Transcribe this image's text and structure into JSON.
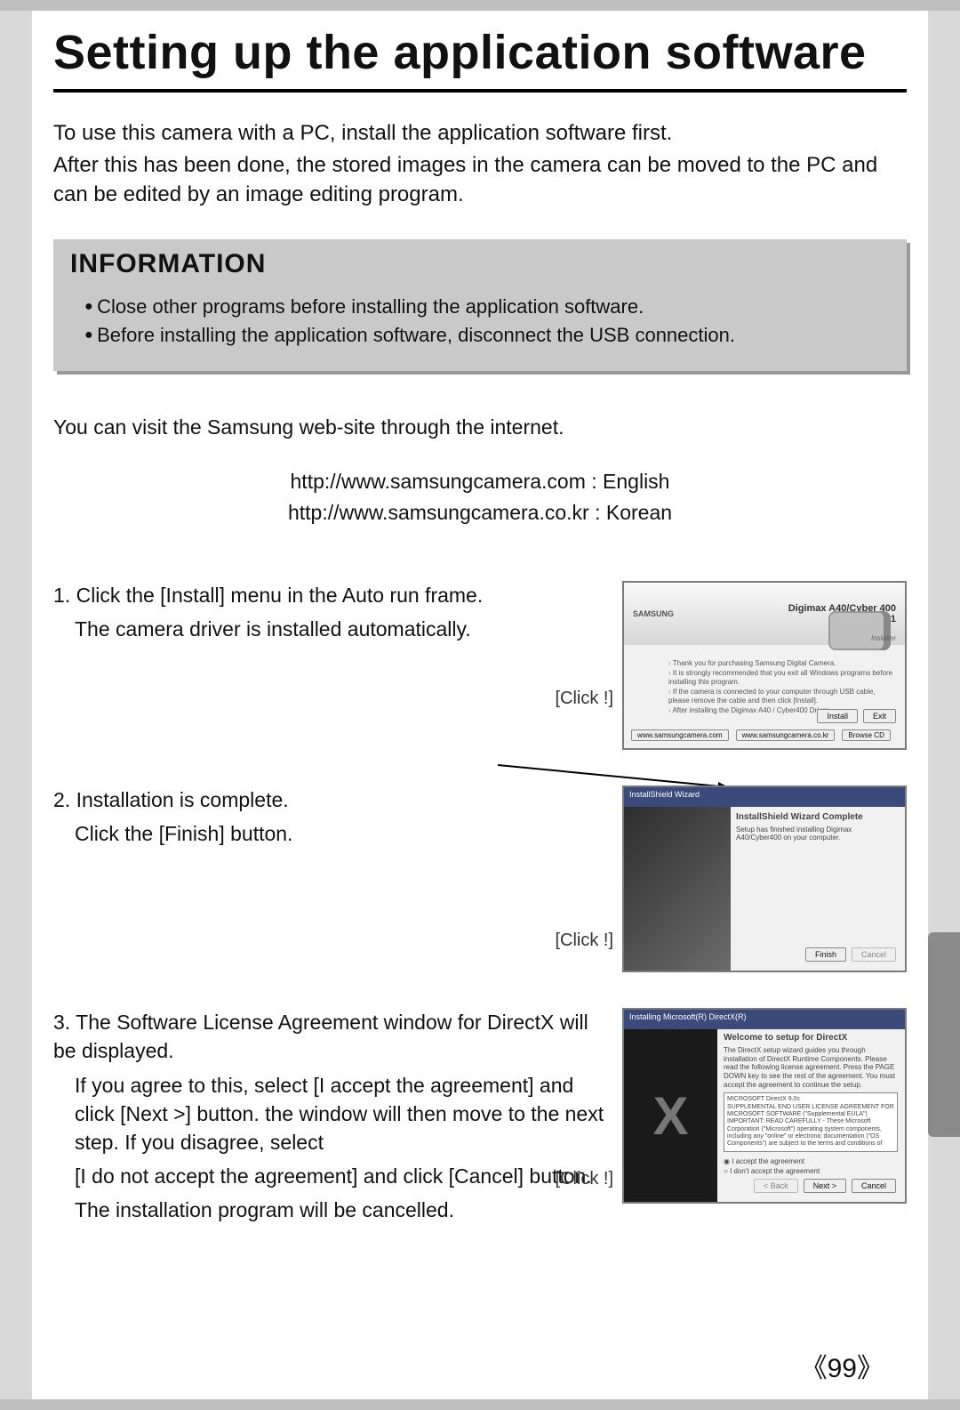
{
  "page": {
    "title": "Setting up the application software",
    "number": "《99》"
  },
  "intro": {
    "l1": "To use this camera with a PC, install the application software first.",
    "l2": "After this has been done, the stored images in the camera can be moved to the PC and can be edited by an image editing program."
  },
  "info": {
    "heading": "INFORMATION",
    "bullets": [
      "Close other programs before installing the application software.",
      "Before installing the application software, disconnect the USB connection."
    ]
  },
  "web": {
    "lead": "You can visit the Samsung web-site through the internet.",
    "links": [
      "http://www.samsungcamera.com : English",
      "http://www.samsungcamera.co.kr : Korean"
    ]
  },
  "steps": [
    {
      "num": "1.",
      "text": [
        "Click the [Install] menu in the Auto run frame.",
        "The camera driver is installed automatically."
      ],
      "click": "[Click !]"
    },
    {
      "num": "2.",
      "text": [
        "Installation is complete.",
        "Click the [Finish] button."
      ],
      "click": "[Click !]"
    },
    {
      "num": "3.",
      "text": [
        "The Software License Agreement window for DirectX will be displayed.",
        "If you agree to this, select [I accept the agreement] and click [Next >] button. the window will then move to the next step. If you disagree, select",
        "[I do not accept the agreement] and click [Cancel] button.",
        "The installation program will be cancelled."
      ],
      "click": "[Click !]"
    }
  ],
  "shot1": {
    "brand": "SAMSUNG",
    "model1": "Digimax A40/Cyber 400",
    "model2": "KENOX Q1",
    "badge": "Installer",
    "bul": [
      "Thank you for purchasing Samsung Digital Camera.",
      "It is strongly recommended that you exit all Windows programs before installing this program.",
      "If the camera is connected to your computer through USB cable, please remove the cable and then click [Install].",
      "After installing the Digimax A40 / Cyber400 Driver,"
    ],
    "btn_install": "Install",
    "btn_exit": "Exit",
    "footer1": "www.samsungcamera.com",
    "footer2": "www.samsungcamera.co.kr",
    "footer3": "Browse CD"
  },
  "shot2": {
    "titlebar": "InstallShield Wizard",
    "heading": "InstallShield Wizard Complete",
    "text": "Setup has finished installing Digimax A40/Cyber400 on your computer.",
    "btn_finish": "Finish",
    "btn_cancel": "Cancel"
  },
  "shot3": {
    "titlebar": "Installing Microsoft(R) DirectX(R)",
    "heading": "Welcome to setup for DirectX",
    "text": "The DirectX setup wizard guides you through installation of DirectX Runtime Components. Please read the following license agreement. Press the PAGE DOWN key to see the rest of the agreement. You must accept the agreement to continue the setup.",
    "box1": "MICROSOFT DirectX 9.0c",
    "box2": "SUPPLEMENTAL END USER LICENSE AGREEMENT FOR MICROSOFT SOFTWARE (\"Supplemental EULA\")",
    "box3": "IMPORTANT: READ CAREFULLY - These Microsoft Corporation (\"Microsoft\") operating system components, including any \"online\" or electronic documentation (\"OS Components\") are subject to the terms and conditions of",
    "radio_accept": "I accept the agreement",
    "radio_decline": "I don't accept the agreement",
    "btn_back": "< Back",
    "btn_next": "Next >",
    "btn_cancel": "Cancel"
  }
}
